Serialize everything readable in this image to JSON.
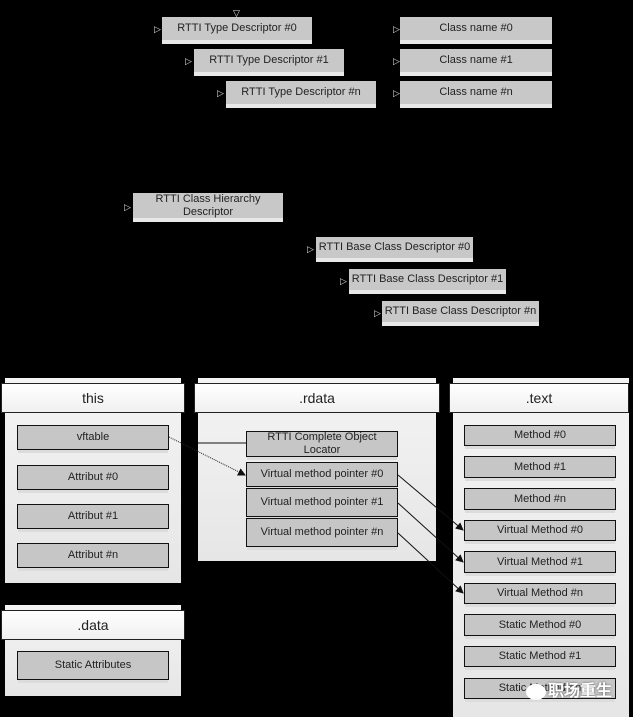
{
  "rtti_type_descriptors": [
    "RTTI Type Descriptor #0",
    "RTTI Type Descriptor #1",
    "RTTI Type Descriptor #n"
  ],
  "class_names": [
    "Class name #0",
    "Class name #1",
    "Class name #n"
  ],
  "class_hierarchy_descriptor": "RTTI Class Hierarchy Descriptor",
  "base_class_descriptors": [
    "RTTI Base Class Descriptor #0",
    "RTTI Base Class Descriptor #1",
    "RTTI Base Class Descriptor #n"
  ],
  "panels": {
    "this": {
      "title": "this",
      "items": [
        "vftable",
        "Attribut #0",
        "Attribut #1",
        "Attribut #n"
      ]
    },
    "rdata": {
      "title": ".rdata",
      "locator": "RTTI Complete Object Locator",
      "items": [
        "Virtual method pointer #0",
        "Virtual method pointer #1",
        "Virtual method pointer #n"
      ]
    },
    "text": {
      "title": ".text",
      "items": [
        "Method #0",
        "Method #1",
        "Method #n",
        "Virtual Method #0",
        "Virtual Method #1",
        "Virtual Method #n",
        "Static Method #0",
        "Static Method #1",
        "Static Method #n"
      ]
    },
    "data": {
      "title": ".data",
      "items": [
        "Static Attributes"
      ]
    }
  },
  "watermark": "职场重生",
  "icons": {
    "connector_triangle": "▷",
    "watermark_logo": "wechat-icon"
  }
}
